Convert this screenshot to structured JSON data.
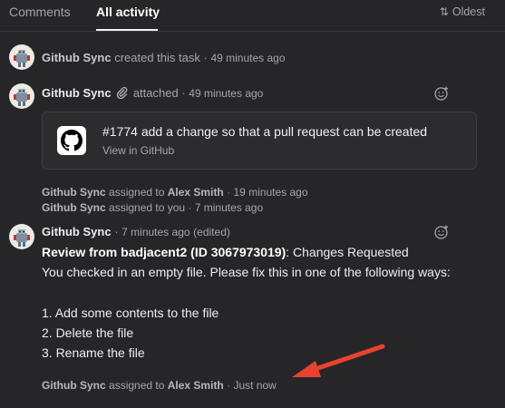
{
  "tabs": {
    "comments": "Comments",
    "all_activity": "All activity"
  },
  "sort": {
    "label": "Oldest",
    "icon": "sort-arrows-icon"
  },
  "activity": {
    "created": {
      "actor": "Github Sync",
      "action": "created this task",
      "time": "49 minutes ago"
    },
    "attached": {
      "actor": "Github Sync",
      "action": "attached",
      "time": "49 minutes ago"
    },
    "attachment": {
      "title": "#1774 add a change so that a pull request can be created",
      "link": "View in GitHub",
      "icon": "github-icon"
    },
    "assigned1": {
      "actor": "Github Sync",
      "action": "assigned to",
      "target": "Alex Smith",
      "time": "19 minutes ago"
    },
    "assigned2": {
      "actor": "Github Sync",
      "action": "assigned to you",
      "time": "7 minutes ago"
    },
    "comment": {
      "actor": "Github Sync",
      "time": "7 minutes ago",
      "edited": "(edited)",
      "review_label": "Review from badjacent2 (ID 3067973019)",
      "review_status": ": Changes Requested",
      "line2": "You checked in an empty file. Please fix this in one of the following ways:",
      "items": [
        "1. Add some contents to the file",
        "2. Delete the file",
        "3. Rename the file"
      ]
    },
    "assigned3": {
      "actor": "Github Sync",
      "action": "assigned to",
      "target": "Alex Smith",
      "time": "Just now"
    }
  },
  "colors": {
    "background": "#262628",
    "arrow": "#e8432e",
    "card": "#2c2c2e"
  }
}
